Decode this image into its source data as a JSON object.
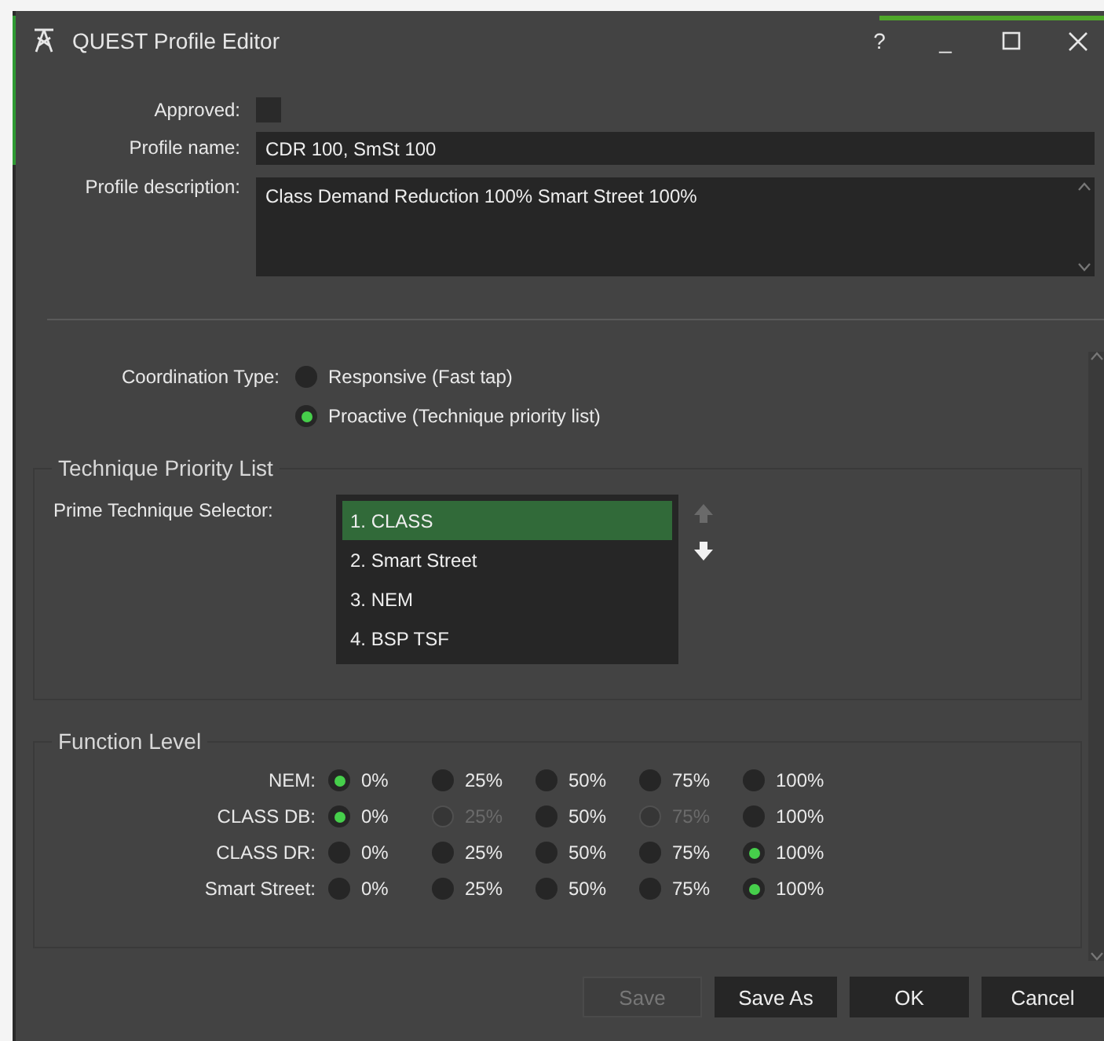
{
  "window": {
    "title": "QUEST Profile Editor",
    "controls": [
      {
        "kind": "help",
        "label": "?"
      },
      {
        "kind": "minimize",
        "label": "_"
      },
      {
        "kind": "maximize"
      },
      {
        "kind": "close"
      }
    ]
  },
  "approved": {
    "label": "Approved:",
    "checked": false
  },
  "profile_name": {
    "label": "Profile name:",
    "value": "CDR 100, SmSt 100"
  },
  "profile_description": {
    "label": "Profile description:",
    "value": "Class Demand Reduction 100% Smart Street 100%"
  },
  "coordination": {
    "label": "Coordination Type:",
    "options": [
      {
        "label": "Responsive (Fast tap)",
        "selected": false
      },
      {
        "label": "Proactive (Technique priority list)",
        "selected": true
      }
    ]
  },
  "technique_priority": {
    "title": "Technique Priority List",
    "selector_label": "Prime Technique Selector:",
    "items": [
      {
        "label": "1. CLASS",
        "selected": true
      },
      {
        "label": "2. Smart Street",
        "selected": false
      },
      {
        "label": "3. NEM",
        "selected": false
      },
      {
        "label": "4. BSP TSF",
        "selected": false
      }
    ],
    "move_up": {
      "disabled": true
    },
    "move_down": {
      "disabled": false
    }
  },
  "function_level": {
    "title": "Function Level",
    "rows": [
      {
        "label": "NEM:",
        "options": [
          {
            "label": "0%",
            "selected": true,
            "disabled": false
          },
          {
            "label": "25%",
            "selected": false,
            "disabled": false
          },
          {
            "label": "50%",
            "selected": false,
            "disabled": false
          },
          {
            "label": "75%",
            "selected": false,
            "disabled": false
          },
          {
            "label": "100%",
            "selected": false,
            "disabled": false
          }
        ]
      },
      {
        "label": "CLASS DB:",
        "options": [
          {
            "label": "0%",
            "selected": true,
            "disabled": false
          },
          {
            "label": "25%",
            "selected": false,
            "disabled": true
          },
          {
            "label": "50%",
            "selected": false,
            "disabled": false
          },
          {
            "label": "75%",
            "selected": false,
            "disabled": true
          },
          {
            "label": "100%",
            "selected": false,
            "disabled": false
          }
        ]
      },
      {
        "label": "CLASS DR:",
        "options": [
          {
            "label": "0%",
            "selected": false,
            "disabled": false
          },
          {
            "label": "25%",
            "selected": false,
            "disabled": false
          },
          {
            "label": "50%",
            "selected": false,
            "disabled": false
          },
          {
            "label": "75%",
            "selected": false,
            "disabled": false
          },
          {
            "label": "100%",
            "selected": true,
            "disabled": false
          }
        ]
      },
      {
        "label": "Smart Street:",
        "options": [
          {
            "label": "0%",
            "selected": false,
            "disabled": false
          },
          {
            "label": "25%",
            "selected": false,
            "disabled": false
          },
          {
            "label": "50%",
            "selected": false,
            "disabled": false
          },
          {
            "label": "75%",
            "selected": false,
            "disabled": false
          },
          {
            "label": "100%",
            "selected": true,
            "disabled": false
          }
        ]
      }
    ]
  },
  "buttons": [
    {
      "label": "Save",
      "disabled": true
    },
    {
      "label": "Save As",
      "disabled": false
    },
    {
      "label": "OK",
      "disabled": false
    },
    {
      "label": "Cancel",
      "disabled": false
    }
  ]
}
